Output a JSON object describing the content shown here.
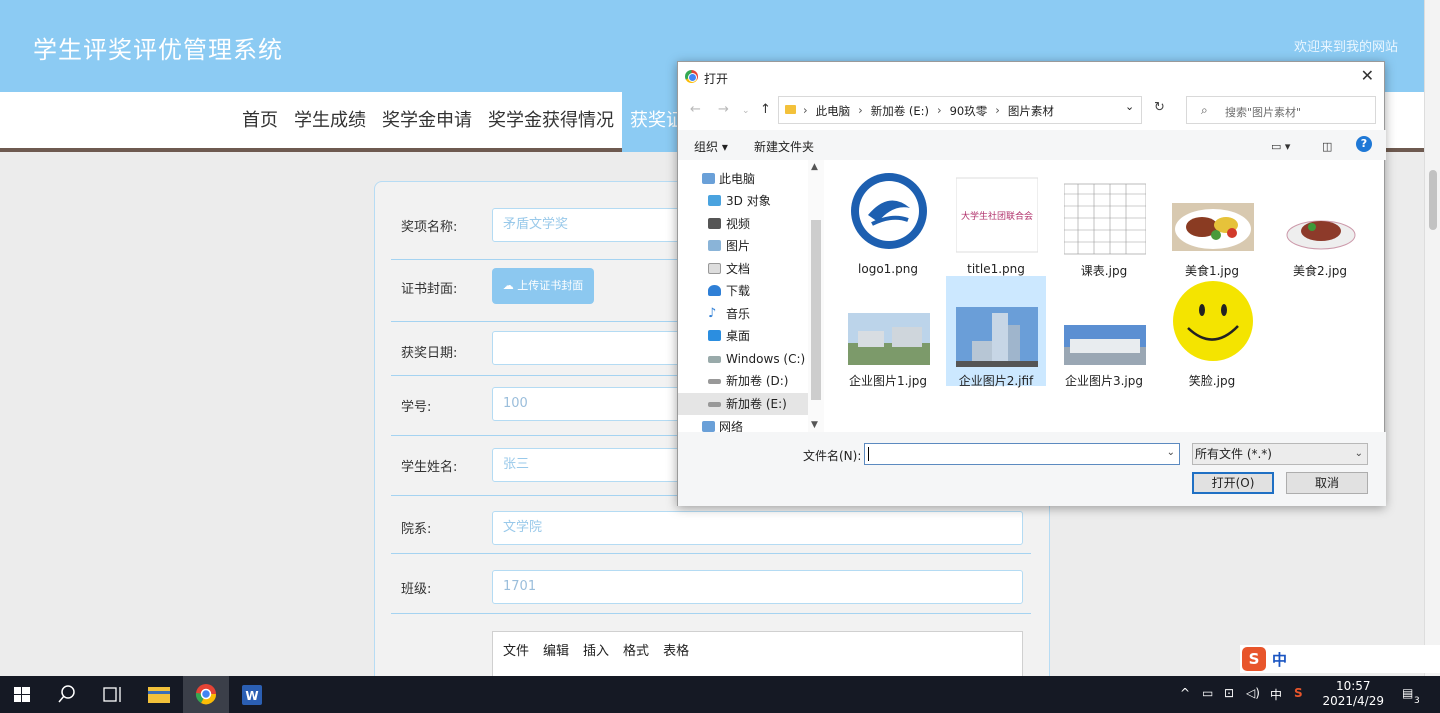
{
  "header": {
    "brand": "学生评奖评优管理系统",
    "welcome": "欢迎来到我的网站"
  },
  "nav": [
    "首页",
    "学生成绩",
    "奖学金申请",
    "奖学金获得情况",
    "获奖证书"
  ],
  "form": {
    "award_label": "奖项名称:",
    "award_value": "矛盾文学奖",
    "cover_label": "证书封面:",
    "upload_label": "上传证书封面",
    "date_label": "获奖日期:",
    "id_label": "学号:",
    "id_value": "100",
    "name_label": "学生姓名:",
    "name_value": "张三",
    "dept_label": "院系:",
    "dept_value": "文学院",
    "class_label": "班级:",
    "class_value": "1701",
    "editor_menu": [
      "文件",
      "编辑",
      "插入",
      "格式",
      "表格"
    ]
  },
  "dialog": {
    "title": "打开",
    "breadcrumbs": [
      "此电脑",
      "新加卷 (E:)",
      "90玖零",
      "图片素材"
    ],
    "search_placeholder": "搜索\"图片素材\"",
    "organize": "组织 ▾",
    "new_folder": "新建文件夹",
    "tree": [
      "此电脑",
      "3D 对象",
      "视频",
      "图片",
      "文档",
      "下载",
      "音乐",
      "桌面",
      "Windows (C:)",
      "新加卷 (D:)",
      "新加卷 (E:)",
      "网络"
    ],
    "files": [
      "logo1.png",
      "title1.png",
      "课表.jpg",
      "美食1.jpg",
      "美食2.jpg",
      "企业图片1.jpg",
      "企业图片2.jfif",
      "企业图片3.jpg",
      "笑脸.jpg"
    ],
    "filename_label": "文件名(N):",
    "filetype": "所有文件 (*.*)",
    "open_btn": "打开(O)",
    "cancel_btn": "取消",
    "title1_text": "大学生社团联合会"
  },
  "taskbar": {
    "time": "10:57",
    "date": "2021/4/29",
    "ime": "中",
    "notif": "3"
  },
  "ime": {
    "label": "中"
  },
  "colors": {
    "header": "#8ccbf3",
    "accent": "#1f70c4",
    "selection": "#cce8ff"
  }
}
